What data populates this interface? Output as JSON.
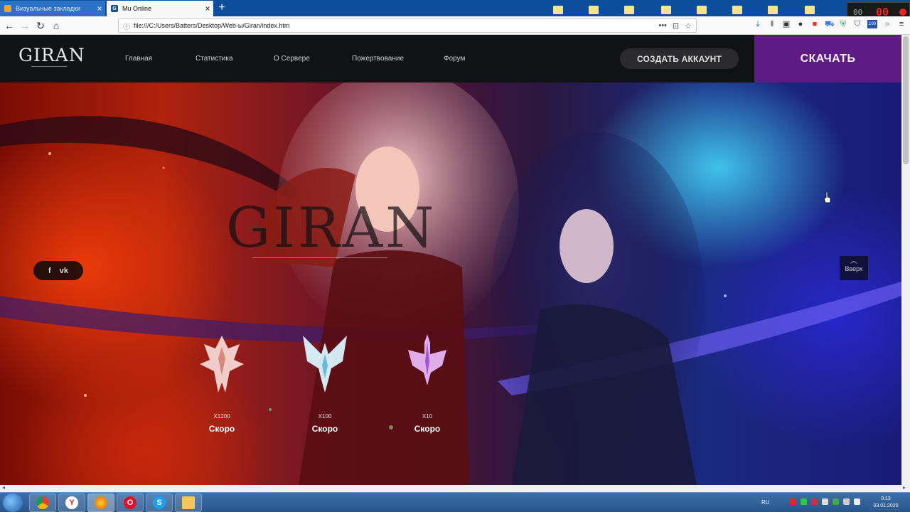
{
  "browser": {
    "tabs": [
      {
        "label": "Визуальные закладки",
        "active": false
      },
      {
        "label": "Mu Online",
        "active": true
      }
    ],
    "new_tab": "+",
    "url": "file:///C:/Users/Batters/Desktop/Web-ы/Giran/index.htm",
    "recorder": {
      "left": "00",
      "right": "00"
    },
    "badge": "100"
  },
  "site": {
    "logo": "GIRAN",
    "menu": [
      "Главная",
      "Статистика",
      "О Сервере",
      "Пожертвование",
      "Форум"
    ],
    "create_account": "СОЗДАТЬ АККАУНТ",
    "download": "СКАЧАТЬ"
  },
  "hero": {
    "logo": "GIRAN",
    "social": {
      "facebook": "f",
      "vk": "vk"
    },
    "to_top": "Вверх",
    "servers": [
      {
        "rate": "X1200",
        "status": "Скоро",
        "emblem_color": "#f4d7d2",
        "glow": "#ff8a6a"
      },
      {
        "rate": "X100",
        "status": "Скоро",
        "emblem_color": "#d9f4fb",
        "glow": "#60d6ff"
      },
      {
        "rate": "X10",
        "status": "Скоро",
        "emblem_color": "#e8b6f7",
        "glow": "#c05cff"
      }
    ]
  },
  "taskbar": {
    "language": "RU",
    "time": "0:13",
    "date": "03.01.2020"
  },
  "colors": {
    "accent_purple": "#5e1b85",
    "header_bg": "#111214",
    "tab_bar": "#0c4d9c"
  }
}
